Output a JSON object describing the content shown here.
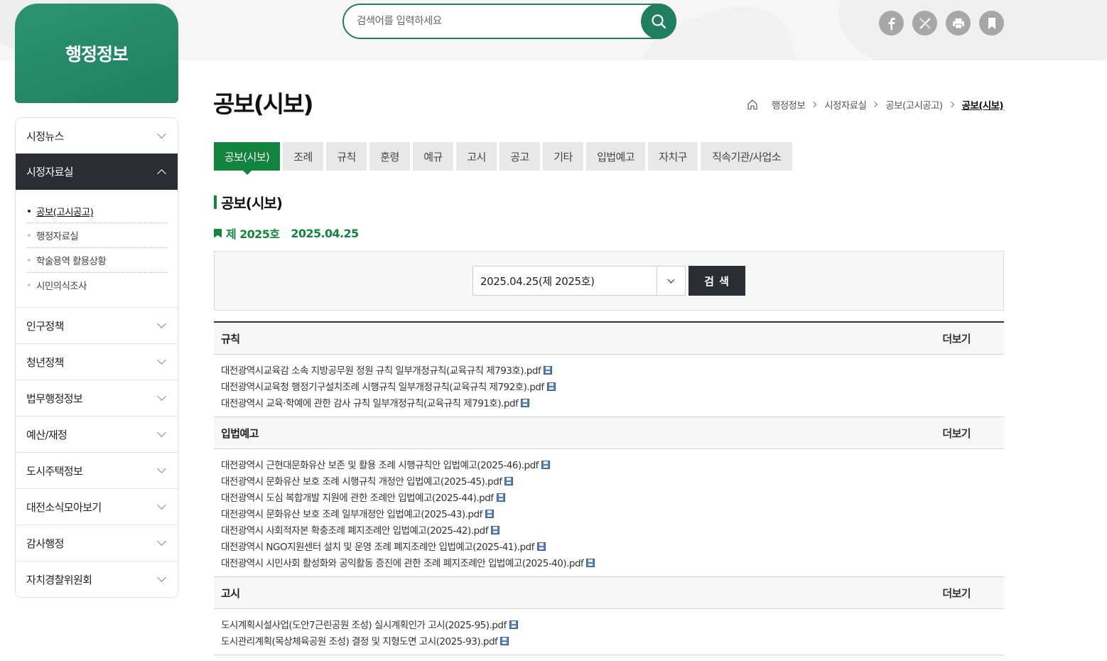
{
  "sidebar": {
    "title": "행정정보",
    "menu": [
      {
        "label": "시정뉴스"
      },
      {
        "label": "시정자료실",
        "active": true,
        "sub": [
          "공보(고시공고)",
          "행정자료실",
          "학술용역 활용상황",
          "시민의식조사"
        ]
      },
      {
        "label": "인구정책"
      },
      {
        "label": "청년정책"
      },
      {
        "label": "법무행정정보"
      },
      {
        "label": "예산/재정"
      },
      {
        "label": "도시주택정보"
      },
      {
        "label": "대전소식모아보기"
      },
      {
        "label": "감사행정"
      },
      {
        "label": "자치경찰위원회"
      }
    ]
  },
  "search": {
    "placeholder": "검색어를 입력하세요"
  },
  "sns_icons": [
    "facebook-icon",
    "x-icon",
    "print-icon",
    "bookmark-icon"
  ],
  "page": {
    "title": "공보(시보)",
    "breadcrumb": [
      "행정정보",
      "시정자료실",
      "공보(고시공고)",
      "공보(시보)"
    ]
  },
  "tabs": [
    "공보(시보)",
    "조례",
    "규칙",
    "훈령",
    "예규",
    "고시",
    "공고",
    "기타",
    "입법예고",
    "자치구",
    "직속기관/사업소"
  ],
  "section": {
    "title": "공보(시보)",
    "issue_no": "제 2025호",
    "issue_date": "2025.04.25"
  },
  "filter": {
    "selected": "2025.04.25(제 2025호)",
    "button": "검 색"
  },
  "board": [
    {
      "title": "규칙",
      "more": "더보기",
      "files": [
        "대전광역시교육감 소속 지방공무원 정원 규칙 일부개정규칙(교육규칙 제793호).pdf",
        "대전광역시교육청 행정기구설치조례 시행규칙 일부개정규칙(교육규칙 제792호).pdf",
        "대전광역시 교육·학예에 관한 감사 규칙 일부개정규칙(교육규칙 제791호).pdf"
      ]
    },
    {
      "title": "입법예고",
      "more": "더보기",
      "files": [
        "대전광역시 근현대문화유산 보존 및 활용 조례 시행규칙안 입법예고(2025-46).pdf",
        "대전광역시 문화유산 보호 조례 시행규칙 개정안 입법예고(2025-45).pdf",
        "대전광역시 도심 복합개발 지원에 관한 조례안 입법예고(2025-44).pdf",
        "대전광역시 문화유산 보호 조례 일부개정안 입법예고(2025-43).pdf",
        "대전광역시 사회적자본 확충조례 폐지조례안 입법예고(2025-42).pdf",
        "대전광역시 NGO지원센터 설치 및 운영 조례 폐지조례안 입법예고(2025-41).pdf",
        "대전광역시 시민사회 활성화와 공익활동 증진에 관한 조례 폐지조례안 입법예고(2025-40).pdf"
      ]
    },
    {
      "title": "고시",
      "more": "더보기",
      "files": [
        "도시계획시설사업(도안7근린공원 조성) 실시계획인가 고시(2025-95).pdf",
        "도시관리계획(목상체육공원 조성) 결정 및 지형도면 고시(2025-93).pdf"
      ]
    }
  ],
  "colors": {
    "accent": "#13843d",
    "brand": "#1f7f5f",
    "dark": "#2a2d33"
  }
}
